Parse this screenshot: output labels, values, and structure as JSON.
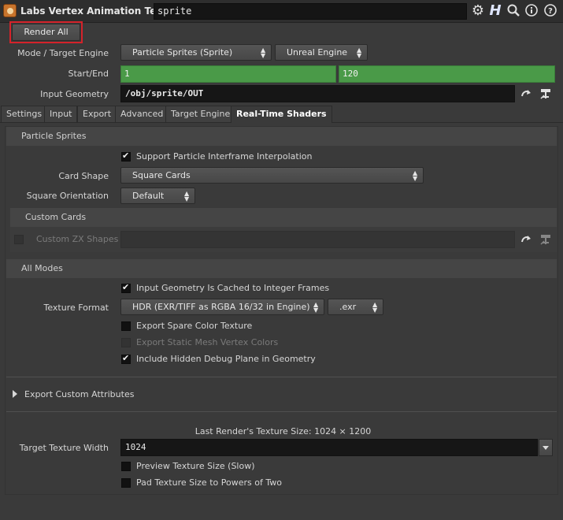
{
  "header": {
    "title": "Labs Vertex Animation Textures",
    "node_name": "sprite",
    "icons": [
      "gear-icon",
      "help-h-icon",
      "search-icon",
      "info-icon",
      "help-icon"
    ]
  },
  "render_all": {
    "label": "Render All",
    "highlight_color": "#d4222a"
  },
  "params": {
    "mode_label": "Mode / Target Engine",
    "mode_value": "Particle Sprites (Sprite)",
    "engine_value": "Unreal Engine",
    "startend_label": "Start/End",
    "start_value": "1",
    "end_value": "120",
    "input_geo_label": "Input Geometry",
    "input_geo_value": "/obj/sprite/OUT"
  },
  "tabs": [
    {
      "label": "Settings",
      "active": false
    },
    {
      "label": "Input",
      "active": false
    },
    {
      "label": "Export",
      "active": false
    },
    {
      "label": "Advanced",
      "active": false
    },
    {
      "label": "Target Engine",
      "active": false
    },
    {
      "label": "Real-Time Shaders",
      "active": true
    }
  ],
  "particle_sprites": {
    "heading": "Particle Sprites",
    "interframe_label": "Support Particle Interframe Interpolation",
    "interframe_checked": true,
    "card_shape_label": "Card Shape",
    "card_shape_value": "Square Cards",
    "square_orient_label": "Square Orientation",
    "square_orient_value": "Default"
  },
  "custom_cards": {
    "heading": "Custom Cards",
    "zx_label": "Custom ZX Shapes",
    "zx_value": ""
  },
  "all_modes": {
    "heading": "All Modes",
    "cached_label": "Input Geometry Is Cached to Integer Frames",
    "cached_checked": true,
    "tex_format_label": "Texture Format",
    "tex_format_value": "HDR (EXR/TIFF as RGBA 16/32 in Engine)",
    "tex_ext_value": ".exr",
    "spare_color_label": "Export Spare Color Texture",
    "spare_color_checked": false,
    "static_mesh_label": "Export Static Mesh Vertex Colors",
    "static_mesh_checked": false,
    "debug_plane_label": "Include Hidden Debug Plane in Geometry",
    "debug_plane_checked": true
  },
  "export_custom": {
    "label": "Export Custom Attributes"
  },
  "texture": {
    "last_render_label": "Last Render's Texture Size: 1024 × 1200",
    "target_width_label": "Target Texture Width",
    "target_width_value": "1024",
    "preview_label": "Preview Texture Size (Slow)",
    "preview_checked": false,
    "pad_label": "Pad Texture Size to Powers of Two",
    "pad_checked": false
  }
}
